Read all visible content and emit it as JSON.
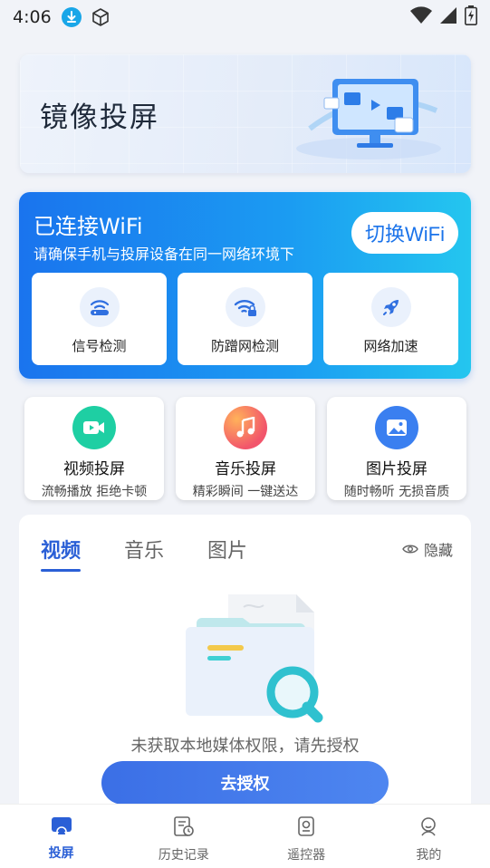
{
  "status_bar": {
    "time": "4:06",
    "icons": [
      "download-icon",
      "cube-icon",
      "wifi-icon",
      "signal-icon",
      "battery-icon"
    ]
  },
  "banner": {
    "title": "镜像投屏"
  },
  "wifi_card": {
    "title": "已连接WiFi",
    "subtitle": "请确保手机与投屏设备在同一网络环境下",
    "switch_label": "切换WiFi",
    "tools": [
      {
        "label": "信号检测",
        "icon": "router-icon"
      },
      {
        "label": "防蹭网检测",
        "icon": "wifi-lock-icon"
      },
      {
        "label": "网络加速",
        "icon": "rocket-icon"
      }
    ]
  },
  "features": [
    {
      "name": "视频投屏",
      "desc": "流畅播放 拒绝卡顿",
      "icon": "video-icon",
      "color": "#1ecfa3"
    },
    {
      "name": "音乐投屏",
      "desc": "精彩瞬间 一键送达",
      "icon": "music-icon",
      "color": "#f2556b"
    },
    {
      "name": "图片投屏",
      "desc": "随时畅听 无损音质",
      "icon": "image-icon",
      "color": "#3a7ff0"
    }
  ],
  "media_panel": {
    "tabs": [
      "视频",
      "音乐",
      "图片"
    ],
    "active_tab": "视频",
    "hide_label": "隐藏",
    "empty_text": "未获取本地媒体权限，请先授权",
    "auth_button": "去授权"
  },
  "bottom_nav": {
    "items": [
      {
        "label": "投屏",
        "icon": "cast-icon",
        "active": true
      },
      {
        "label": "历史记录",
        "icon": "history-icon",
        "active": false
      },
      {
        "label": "遥控器",
        "icon": "remote-icon",
        "active": false
      },
      {
        "label": "我的",
        "icon": "profile-icon",
        "active": false
      }
    ]
  },
  "colors": {
    "accent": "#2a5fd6",
    "wifi_gradient_start": "#1a74ee",
    "wifi_gradient_end": "#24c6ef"
  }
}
